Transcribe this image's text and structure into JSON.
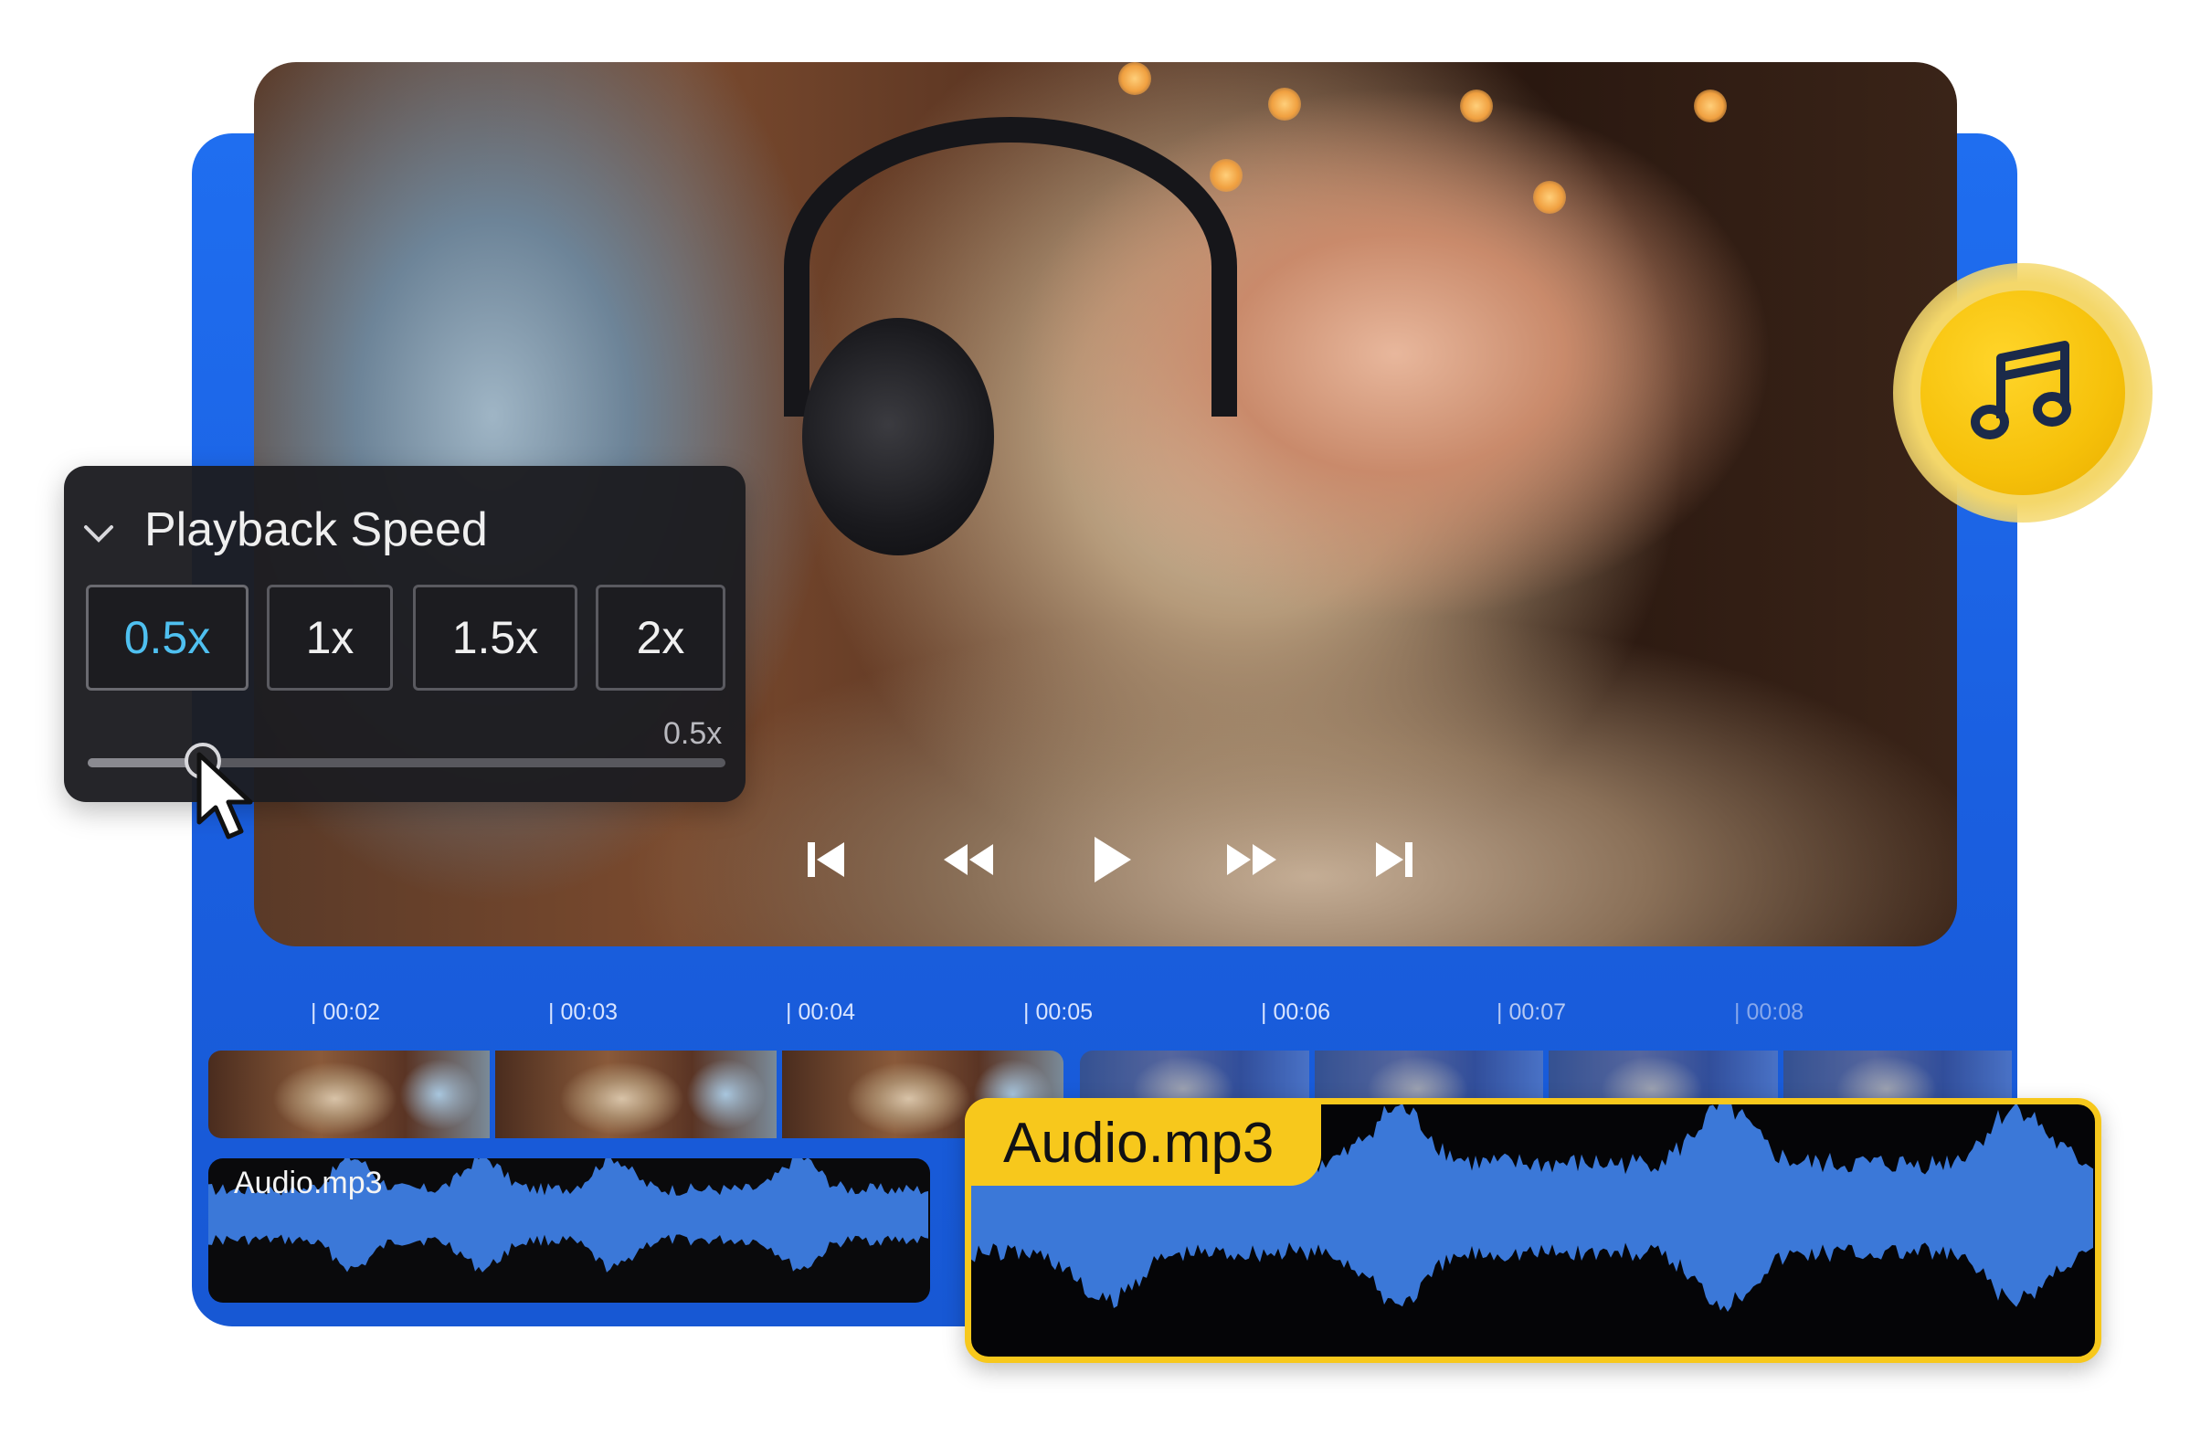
{
  "speed_panel": {
    "title": "Playback Speed",
    "options": [
      "0.5x",
      "1x",
      "1.5x",
      "2x"
    ],
    "selected": "0.5x",
    "current_value_label": "0.5x",
    "slider_fraction": 0.18
  },
  "media_controls": [
    "skip-to-start",
    "rewind",
    "play",
    "fast-forward",
    "skip-to-end"
  ],
  "timeline": {
    "ticks": [
      "00:02",
      "00:03",
      "00:04",
      "00:05",
      "00:06",
      "00:07",
      "00:08"
    ]
  },
  "tracks": {
    "audio_clip_left": {
      "label": "Audio.mp3"
    },
    "audio_clip_selected": {
      "label": "Audio.mp3"
    }
  },
  "colors": {
    "backdrop_blue": "#1f6ef0",
    "selected_speed": "#4fc0f0",
    "clip_highlight": "#f7c81c",
    "waveform": "#3b78d8",
    "badge_yellow": "#f6c10a"
  },
  "icons": {
    "badge": "music-note-icon",
    "panel_toggle": "chevron-down-icon",
    "pointer": "cursor-icon"
  }
}
